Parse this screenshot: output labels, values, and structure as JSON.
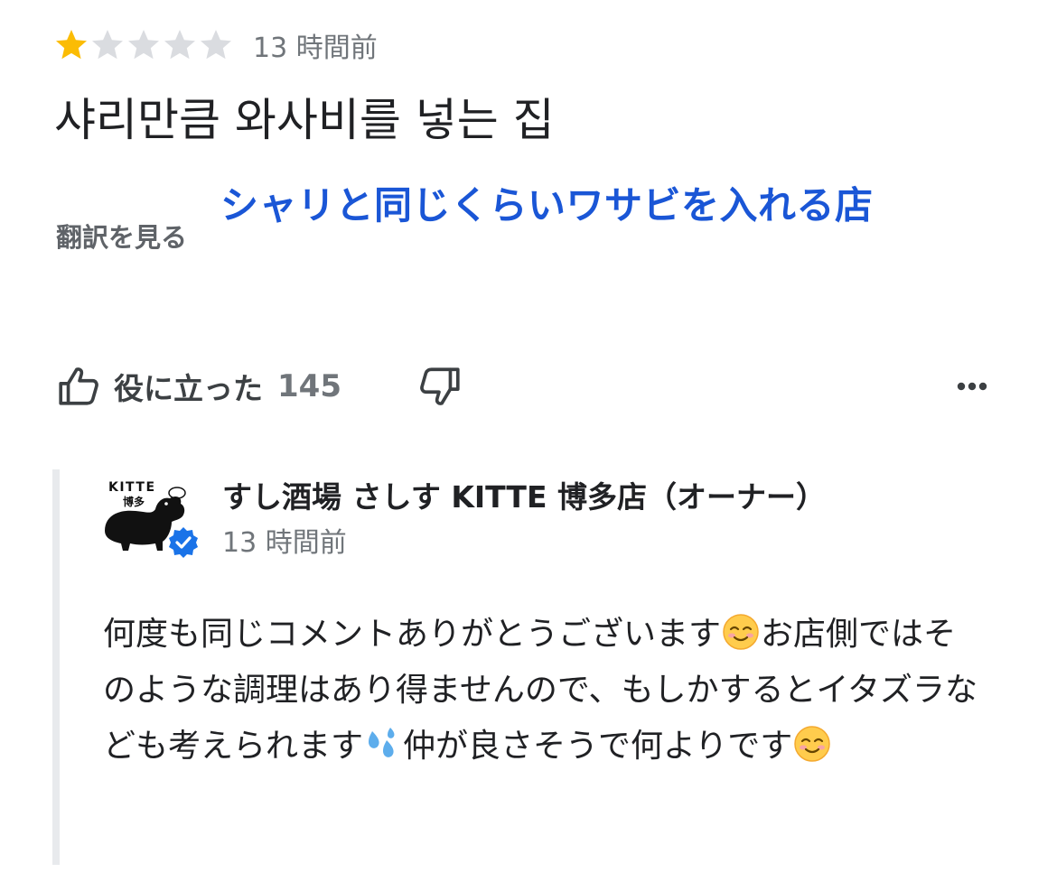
{
  "review": {
    "rating": 1,
    "max_rating": 5,
    "time": "13 時間前",
    "title": "샤리만큼 와사비를 넣는 집",
    "translate_link": "翻訳を見る",
    "translation_overlay": "シャリと同じくらいワサビを入れる店"
  },
  "actions": {
    "helpful_label": "役に立った",
    "helpful_count": "145"
  },
  "owner_reply": {
    "avatar_text_top": "KITTE",
    "avatar_text_bottom": "博多",
    "name": "すし酒場 さしす KITTE 博多店（オーナー）",
    "time": "13 時間前",
    "body_part1": "何度も同じコメントありがとうございます",
    "body_part2": "お店側ではそのような調理はあり得ませんので、もしかするとイタズラなども考えられます",
    "body_part3": "仲が良さそうで何よりです"
  },
  "colors": {
    "star_filled": "#fbbc04",
    "star_empty": "#dadce0",
    "translation_blue": "#1a56d6",
    "verified_blue": "#1a73e8"
  }
}
